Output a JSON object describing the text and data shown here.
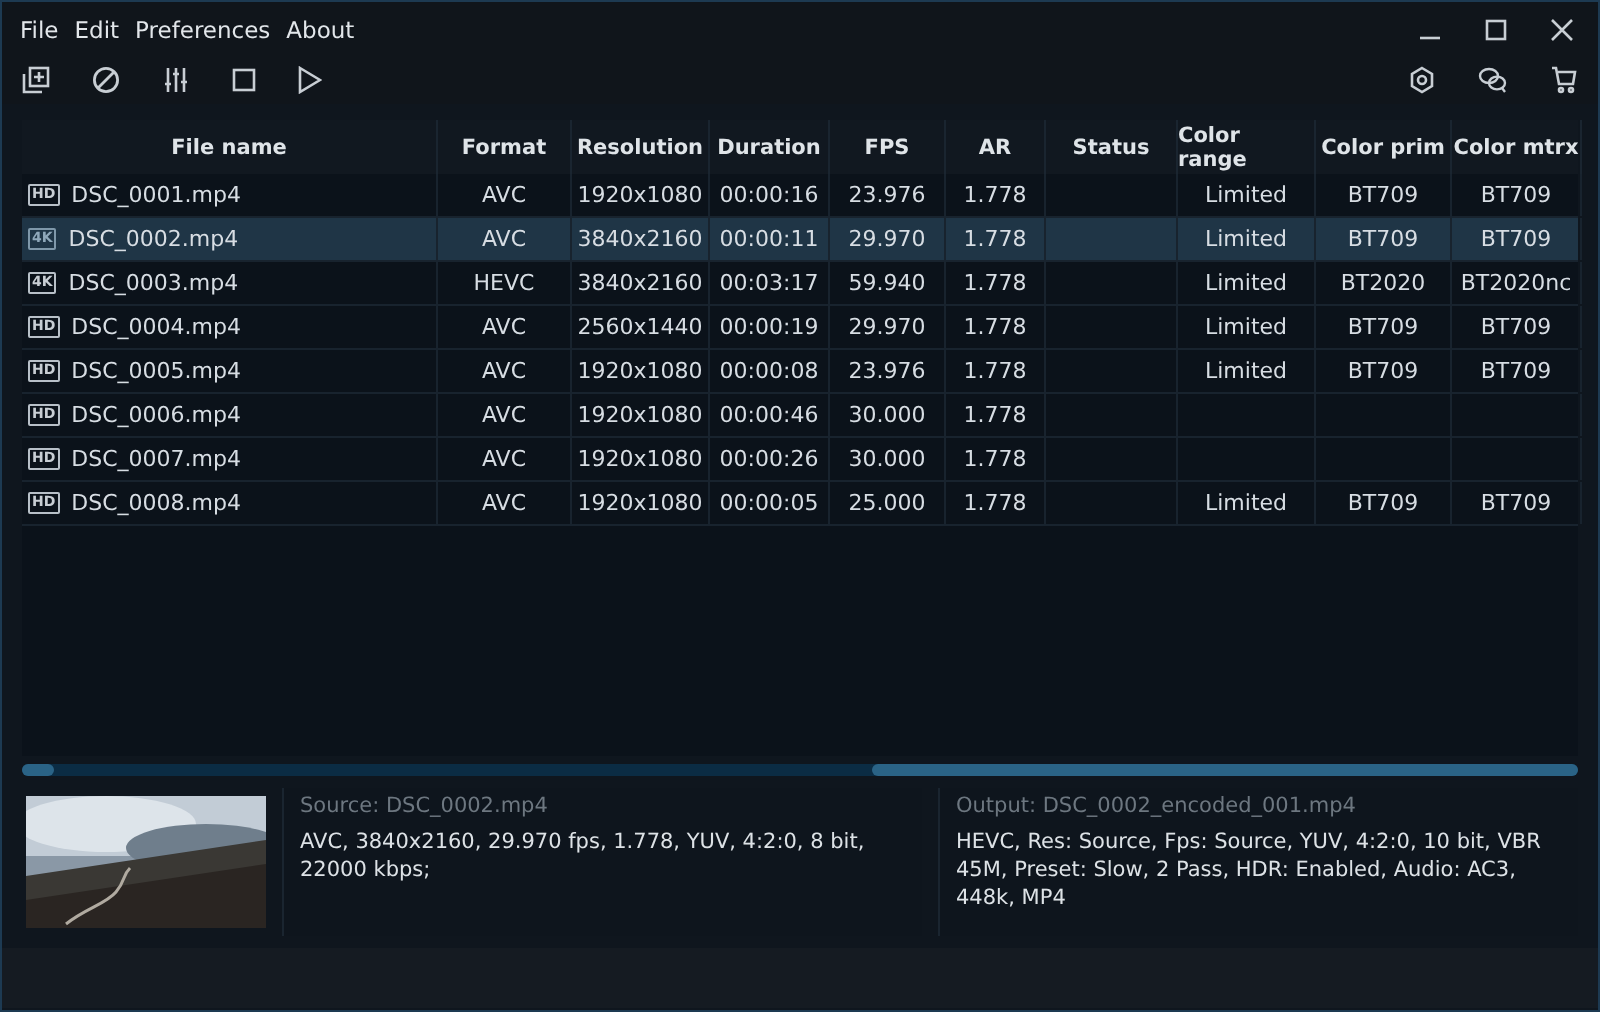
{
  "menu": [
    "File",
    "Edit",
    "Preferences",
    "About"
  ],
  "table": {
    "columns": [
      "File name",
      "Format",
      "Resolution",
      "Duration",
      "FPS",
      "AR",
      "Status",
      "Color range",
      "Color prim",
      "Color mtrx"
    ],
    "rows": [
      {
        "badge": "HD",
        "selected": false,
        "cells": [
          "DSC_0001.mp4",
          "AVC",
          "1920x1080",
          "00:00:16",
          "23.976",
          "1.778",
          "",
          "Limited",
          "BT709",
          "BT709"
        ]
      },
      {
        "badge": "4K",
        "selected": true,
        "cells": [
          "DSC_0002.mp4",
          "AVC",
          "3840x2160",
          "00:00:11",
          "29.970",
          "1.778",
          "",
          "Limited",
          "BT709",
          "BT709"
        ]
      },
      {
        "badge": "4K",
        "selected": false,
        "cells": [
          "DSC_0003.mp4",
          "HEVC",
          "3840x2160",
          "00:03:17",
          "59.940",
          "1.778",
          "",
          "Limited",
          "BT2020",
          "BT2020nc"
        ]
      },
      {
        "badge": "HD",
        "selected": false,
        "cells": [
          "DSC_0004.mp4",
          "AVC",
          "2560x1440",
          "00:00:19",
          "29.970",
          "1.778",
          "",
          "Limited",
          "BT709",
          "BT709"
        ]
      },
      {
        "badge": "HD",
        "selected": false,
        "cells": [
          "DSC_0005.mp4",
          "AVC",
          "1920x1080",
          "00:00:08",
          "23.976",
          "1.778",
          "",
          "Limited",
          "BT709",
          "BT709"
        ]
      },
      {
        "badge": "HD",
        "selected": false,
        "cells": [
          "DSC_0006.mp4",
          "AVC",
          "1920x1080",
          "00:00:46",
          "30.000",
          "1.778",
          "",
          "",
          "",
          ""
        ]
      },
      {
        "badge": "HD",
        "selected": false,
        "cells": [
          "DSC_0007.mp4",
          "AVC",
          "1920x1080",
          "00:00:26",
          "30.000",
          "1.778",
          "",
          "",
          "",
          ""
        ]
      },
      {
        "badge": "HD",
        "selected": false,
        "cells": [
          "DSC_0008.mp4",
          "AVC",
          "1920x1080",
          "00:00:05",
          "25.000",
          "1.778",
          "",
          "Limited",
          "BT709",
          "BT709"
        ]
      }
    ]
  },
  "source": {
    "title": "Source: DSC_0002.mp4",
    "details": "AVC, 3840x2160, 29.970 fps, 1.778, YUV, 4:2:0, 8 bit, 22000 kbps;"
  },
  "output": {
    "title": "Output: DSC_0002_encoded_001.mp4",
    "details": "HEVC, Res: Source, Fps: Source, YUV, 4:2:0, 10 bit, VBR 45M, Preset: Slow, 2 Pass, HDR: Enabled, Audio: AC3, 448k, MP4"
  }
}
